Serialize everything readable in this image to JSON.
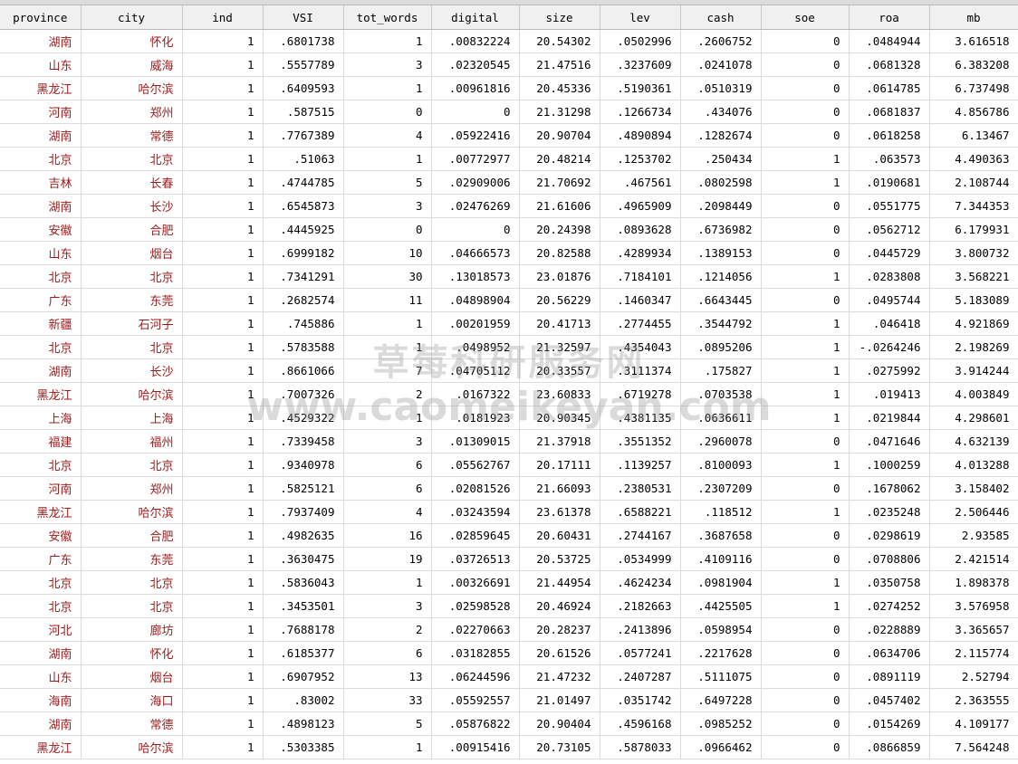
{
  "columns": [
    "province",
    "city",
    "ind",
    "VSI",
    "tot_words",
    "digital",
    "size",
    "lev",
    "cash",
    "soe",
    "roa",
    "mb"
  ],
  "rows": [
    [
      "湖南",
      "怀化",
      "1",
      ".6801738",
      "1",
      ".00832224",
      "20.54302",
      ".0502996",
      ".2606752",
      "0",
      ".0484944",
      "3.616518"
    ],
    [
      "山东",
      "威海",
      "1",
      ".5557789",
      "3",
      ".02320545",
      "21.47516",
      ".3237609",
      ".0241078",
      "0",
      ".0681328",
      "6.383208"
    ],
    [
      "黑龙江",
      "哈尔滨",
      "1",
      ".6409593",
      "1",
      ".00961816",
      "20.45336",
      ".5190361",
      ".0510319",
      "0",
      ".0614785",
      "6.737498"
    ],
    [
      "河南",
      "郑州",
      "1",
      ".587515",
      "0",
      "0",
      "21.31298",
      ".1266734",
      ".434076",
      "0",
      ".0681837",
      "4.856786"
    ],
    [
      "湖南",
      "常德",
      "1",
      ".7767389",
      "4",
      ".05922416",
      "20.90704",
      ".4890894",
      ".1282674",
      "0",
      ".0618258",
      "6.13467"
    ],
    [
      "北京",
      "北京",
      "1",
      ".51063",
      "1",
      ".00772977",
      "20.48214",
      ".1253702",
      ".250434",
      "1",
      ".063573",
      "4.490363"
    ],
    [
      "吉林",
      "长春",
      "1",
      ".4744785",
      "5",
      ".02909006",
      "21.70692",
      ".467561",
      ".0802598",
      "1",
      ".0190681",
      "2.108744"
    ],
    [
      "湖南",
      "长沙",
      "1",
      ".6545873",
      "3",
      ".02476269",
      "21.61606",
      ".4965909",
      ".2098449",
      "0",
      ".0551775",
      "7.344353"
    ],
    [
      "安徽",
      "合肥",
      "1",
      ".4445925",
      "0",
      "0",
      "20.24398",
      ".0893628",
      ".6736982",
      "0",
      ".0562712",
      "6.179931"
    ],
    [
      "山东",
      "烟台",
      "1",
      ".6999182",
      "10",
      ".04666573",
      "20.82588",
      ".4289934",
      ".1389153",
      "0",
      ".0445729",
      "3.800732"
    ],
    [
      "北京",
      "北京",
      "1",
      ".7341291",
      "30",
      ".13018573",
      "23.01876",
      ".7184101",
      ".1214056",
      "1",
      ".0283808",
      "3.568221"
    ],
    [
      "广东",
      "东莞",
      "1",
      ".2682574",
      "11",
      ".04898904",
      "20.56229",
      ".1460347",
      ".6643445",
      "0",
      ".0495744",
      "5.183089"
    ],
    [
      "新疆",
      "石河子",
      "1",
      ".745886",
      "1",
      ".00201959",
      "20.41713",
      ".2774455",
      ".3544792",
      "1",
      ".046418",
      "4.921869"
    ],
    [
      "北京",
      "北京",
      "1",
      ".5783588",
      "1",
      ".0498952",
      "21.32597",
      ".4354043",
      ".0895206",
      "1",
      "-.0264246",
      "2.198269"
    ],
    [
      "湖南",
      "长沙",
      "1",
      ".8661066",
      "7",
      ".04705112",
      "20.33557",
      ".3111374",
      ".175827",
      "1",
      ".0275992",
      "3.914244"
    ],
    [
      "黑龙江",
      "哈尔滨",
      "1",
      ".7007326",
      "2",
      ".0167322",
      "23.60833",
      ".6719278",
      ".0703538",
      "1",
      ".019413",
      "4.003849"
    ],
    [
      "上海",
      "上海",
      "1",
      ".4529322",
      "1",
      ".0181923",
      "20.90345",
      ".4381135",
      ".0636611",
      "1",
      ".0219844",
      "4.298601"
    ],
    [
      "福建",
      "福州",
      "1",
      ".7339458",
      "3",
      ".01309015",
      "21.37918",
      ".3551352",
      ".2960078",
      "0",
      ".0471646",
      "4.632139"
    ],
    [
      "北京",
      "北京",
      "1",
      ".9340978",
      "6",
      ".05562767",
      "20.17111",
      ".1139257",
      ".8100093",
      "1",
      ".1000259",
      "4.013288"
    ],
    [
      "河南",
      "郑州",
      "1",
      ".5825121",
      "6",
      ".02081526",
      "21.66093",
      ".2380531",
      ".2307209",
      "0",
      ".1678062",
      "3.158402"
    ],
    [
      "黑龙江",
      "哈尔滨",
      "1",
      ".7937409",
      "4",
      ".03243594",
      "23.61378",
      ".6588221",
      ".118512",
      "1",
      ".0235248",
      "2.506446"
    ],
    [
      "安徽",
      "合肥",
      "1",
      ".4982635",
      "16",
      ".02859645",
      "20.60431",
      ".2744167",
      ".3687658",
      "0",
      ".0298619",
      "2.93585"
    ],
    [
      "广东",
      "东莞",
      "1",
      ".3630475",
      "19",
      ".03726513",
      "20.53725",
      ".0534999",
      ".4109116",
      "0",
      ".0708806",
      "2.421514"
    ],
    [
      "北京",
      "北京",
      "1",
      ".5836043",
      "1",
      ".00326691",
      "21.44954",
      ".4624234",
      ".0981904",
      "1",
      ".0350758",
      "1.898378"
    ],
    [
      "北京",
      "北京",
      "1",
      ".3453501",
      "3",
      ".02598528",
      "20.46924",
      ".2182663",
      ".4425505",
      "1",
      ".0274252",
      "3.576958"
    ],
    [
      "河北",
      "廊坊",
      "1",
      ".7688178",
      "2",
      ".02270663",
      "20.28237",
      ".2413896",
      ".0598954",
      "0",
      ".0228889",
      "3.365657"
    ],
    [
      "湖南",
      "怀化",
      "1",
      ".6185377",
      "6",
      ".03182855",
      "20.61526",
      ".0577241",
      ".2217628",
      "0",
      ".0634706",
      "2.115774"
    ],
    [
      "山东",
      "烟台",
      "1",
      ".6907952",
      "13",
      ".06244596",
      "21.47232",
      ".2407287",
      ".5111075",
      "0",
      ".0891119",
      "2.52794"
    ],
    [
      "海南",
      "海口",
      "1",
      ".83002",
      "33",
      ".05592557",
      "21.01497",
      ".0351742",
      ".6497228",
      "0",
      ".0457402",
      "2.363555"
    ],
    [
      "湖南",
      "常德",
      "1",
      ".4898123",
      "5",
      ".05876822",
      "20.90404",
      ".4596168",
      ".0985252",
      "0",
      ".0154269",
      "4.109177"
    ],
    [
      "黑龙江",
      "哈尔滨",
      "1",
      ".5303385",
      "1",
      ".00915416",
      "20.73105",
      ".5878033",
      ".0966462",
      "0",
      ".0866859",
      "7.564248"
    ]
  ],
  "watermark": {
    "line1": "草莓科研服务网",
    "line2": "www.caomeikeyan.com"
  }
}
